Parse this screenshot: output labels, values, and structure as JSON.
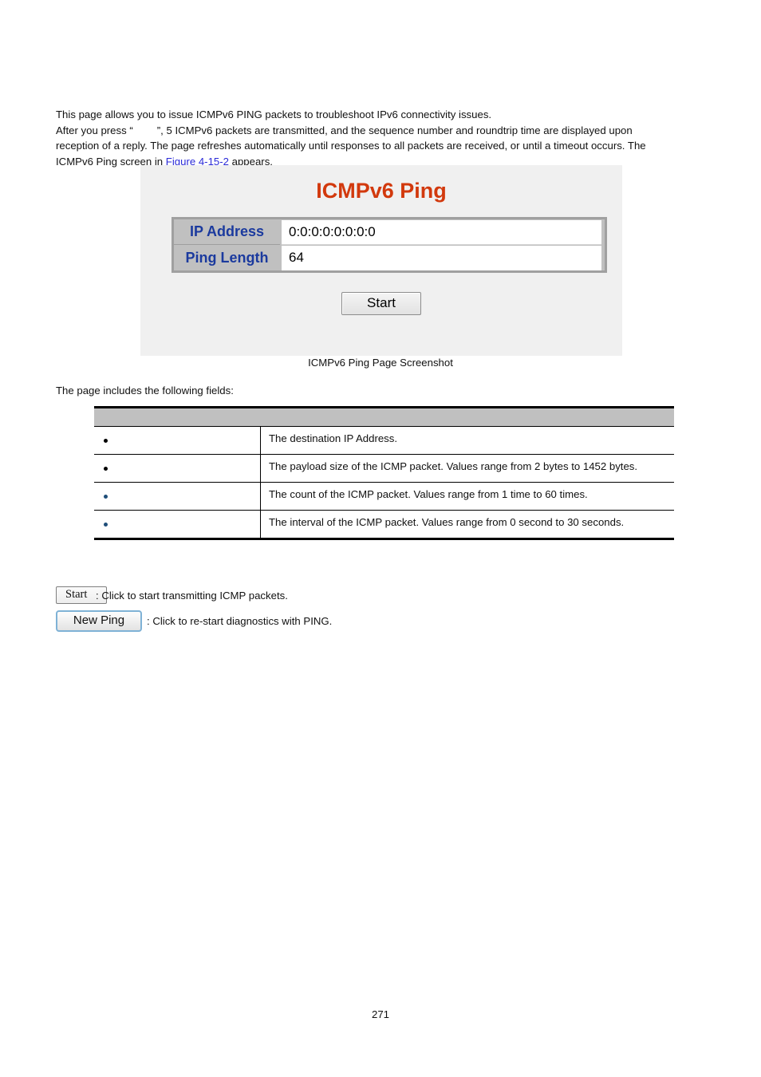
{
  "intro": {
    "line1": "This page allows you to issue ICMPv6 PING packets to troubleshoot IPv6 connectivity issues.",
    "line2_pre": "After you press “",
    "line2_post": "”, 5 ICMPv6 packets are transmitted, and the sequence number and roundtrip time are displayed upon",
    "line3": "reception of a reply. The page refreshes automatically until responses to all packets are received, or until a timeout occurs. The",
    "line4_pre": "ICMPv6 Ping screen in ",
    "line4_link": "Figure 4-15-2",
    "line4_post": " appears."
  },
  "screenshot": {
    "title": "ICMPv6 Ping",
    "rows": [
      {
        "label": "IP Address",
        "value": "0:0:0:0:0:0:0:0"
      },
      {
        "label": "Ping Length",
        "value": "64"
      }
    ],
    "start_button": "Start",
    "title_color": "#d2390d",
    "label_color": "#1b3a9e",
    "label_bg": "#c0c0c0",
    "panel_bg": "#f0f0f0"
  },
  "caption": "ICMPv6 Ping Page Screenshot",
  "lead_in": "The page includes the following fields:",
  "fields_table": {
    "headers": [
      "",
      ""
    ],
    "rows": [
      {
        "name": "",
        "description": "The destination IP Address."
      },
      {
        "name": "",
        "description": "The payload size of the ICMP packet. Values range from 2 bytes to 1452 bytes."
      },
      {
        "name": "",
        "description": "The count of the ICMP packet. Values range from 1 time to 60 times."
      },
      {
        "name": "",
        "description": "The interval of the ICMP packet. Values range from 0 second to 30 seconds."
      }
    ]
  },
  "legend": {
    "start_button": "Start",
    "start_text": ": Click to start transmitting ICMP packets.",
    "newping_button": "New Ping",
    "newping_text": ": Click to re-start diagnostics with PING."
  },
  "page_number": "271"
}
